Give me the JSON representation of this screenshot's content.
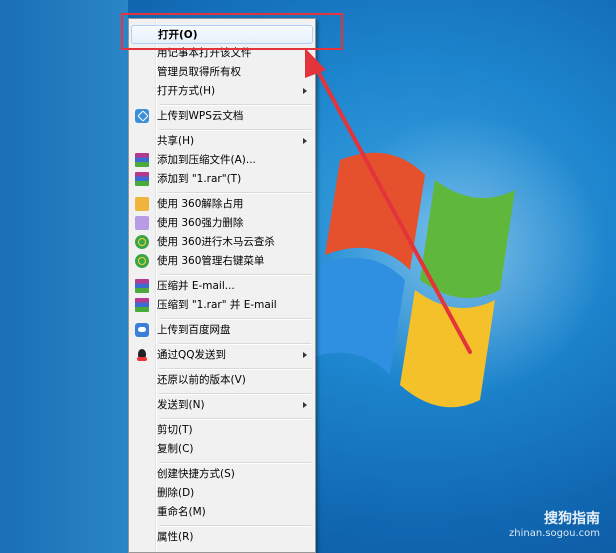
{
  "menu": {
    "items": [
      {
        "label": "打开(O)",
        "icon": "",
        "submenu": false,
        "bold": true
      },
      {
        "label": "用记事本打开该文件",
        "icon": "",
        "submenu": false
      },
      {
        "label": "管理员取得所有权",
        "icon": "",
        "submenu": false
      },
      {
        "label": "打开方式(H)",
        "icon": "",
        "submenu": true
      },
      {
        "label": "上传到WPS云文档",
        "icon": "wps-cloud-icon",
        "submenu": false
      },
      {
        "label": "共享(H)",
        "icon": "",
        "submenu": true
      },
      {
        "label": "添加到压缩文件(A)...",
        "icon": "winrar-icon",
        "submenu": false
      },
      {
        "label": "添加到 \"1.rar\"(T)",
        "icon": "winrar-icon",
        "submenu": false
      },
      {
        "label": "使用 360解除占用",
        "icon": "360-unlock-icon",
        "submenu": false
      },
      {
        "label": "使用 360强力删除",
        "icon": "360-shred-icon",
        "submenu": false
      },
      {
        "label": "使用 360进行木马云查杀",
        "icon": "360-scan-icon",
        "submenu": false
      },
      {
        "label": "使用 360管理右键菜单",
        "icon": "360-scan-icon",
        "submenu": false
      },
      {
        "label": "压缩并 E-mail...",
        "icon": "winrar-icon",
        "submenu": false
      },
      {
        "label": "压缩到 \"1.rar\" 并 E-mail",
        "icon": "winrar-icon",
        "submenu": false
      },
      {
        "label": "上传到百度网盘",
        "icon": "baidu-netdisk-icon",
        "submenu": false
      },
      {
        "label": "通过QQ发送到",
        "icon": "qq-icon",
        "submenu": true
      },
      {
        "label": "还原以前的版本(V)",
        "icon": "",
        "submenu": false
      },
      {
        "label": "发送到(N)",
        "icon": "",
        "submenu": true
      },
      {
        "label": "剪切(T)",
        "icon": "",
        "submenu": false
      },
      {
        "label": "复制(C)",
        "icon": "",
        "submenu": false
      },
      {
        "label": "创建快捷方式(S)",
        "icon": "",
        "submenu": false
      },
      {
        "label": "删除(D)",
        "icon": "",
        "submenu": false
      },
      {
        "label": "重命名(M)",
        "icon": "",
        "submenu": false
      },
      {
        "label": "属性(R)",
        "icon": "",
        "submenu": false
      }
    ]
  },
  "watermark": {
    "brand": "搜狗指南",
    "site": "zhinan.sogou.com"
  },
  "colors": {
    "highlight_box": "#e2343a",
    "arrow": "#e2343a",
    "desktop": "#1c84cc"
  }
}
